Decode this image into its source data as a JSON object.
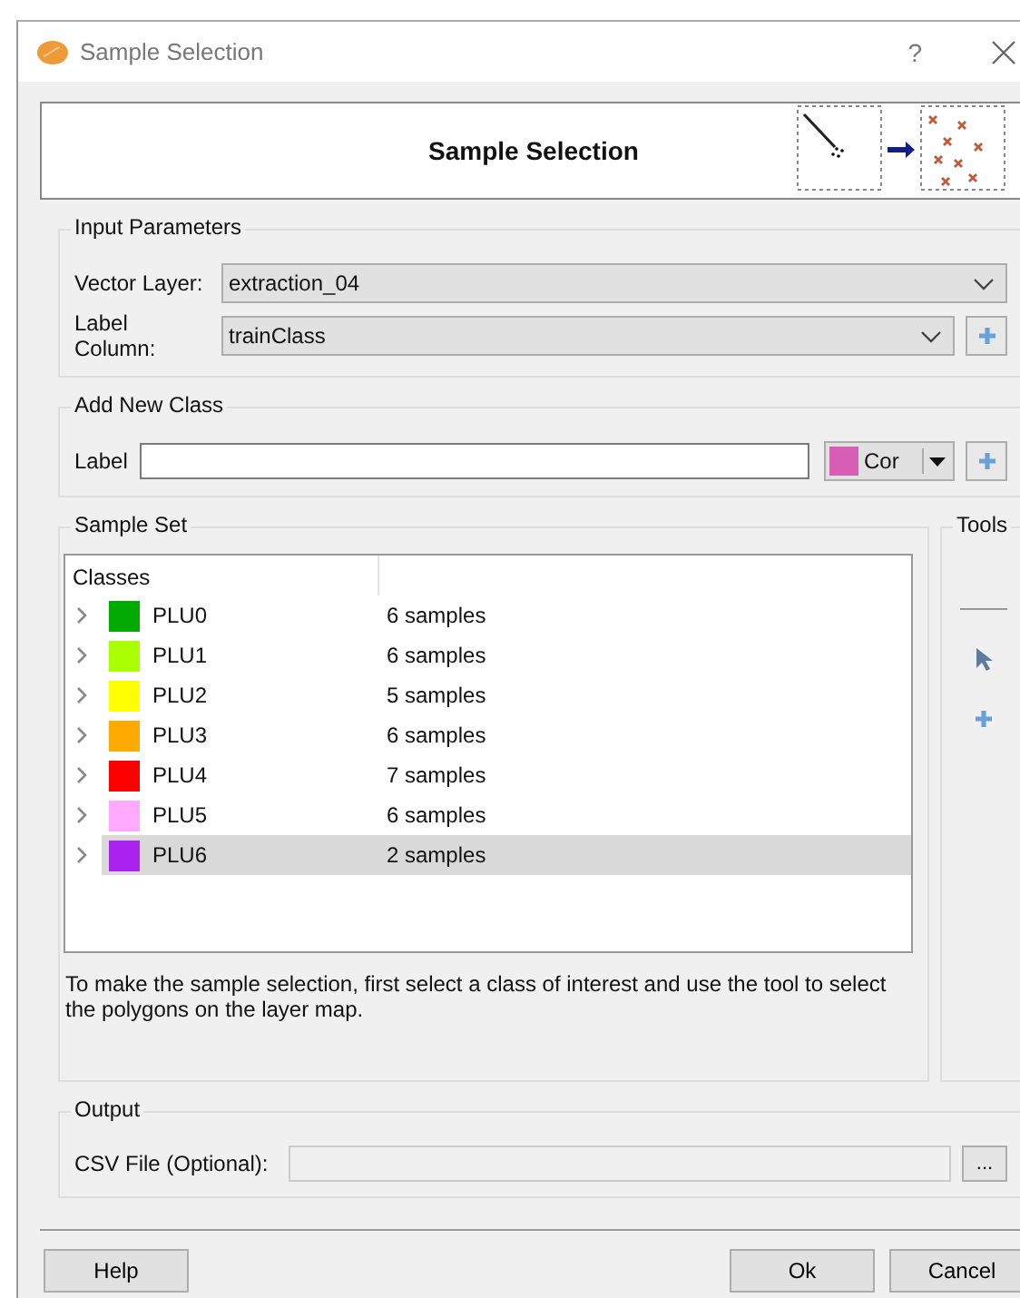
{
  "window": {
    "title": "Sample Selection",
    "help": "?"
  },
  "banner": {
    "title": "Sample Selection"
  },
  "input_parameters": {
    "title": "Input Parameters",
    "vector_layer": {
      "label": "Vector Layer:",
      "value": "extraction_04"
    },
    "label_column": {
      "label": "Label Column:",
      "value": "trainClass"
    }
  },
  "add_new_class": {
    "title": "Add New Class",
    "label": "Label",
    "color": {
      "text": "Cor",
      "color": "#d65fb4"
    }
  },
  "sample_set": {
    "title": "Sample Set",
    "columns": [
      "Classes"
    ],
    "rows": [
      {
        "label": "PLU0",
        "count": "6 samples",
        "color": "#00aa00",
        "selected": false
      },
      {
        "label": "PLU1",
        "count": "6 samples",
        "color": "#aaff00",
        "selected": false
      },
      {
        "label": "PLU2",
        "count": "5 samples",
        "color": "#ffff00",
        "selected": false
      },
      {
        "label": "PLU3",
        "count": "6 samples",
        "color": "#ffaa00",
        "selected": false
      },
      {
        "label": "PLU4",
        "count": "7 samples",
        "color": "#ff0000",
        "selected": false
      },
      {
        "label": "PLU5",
        "count": "6 samples",
        "color": "#ffaaff",
        "selected": false
      },
      {
        "label": "PLU6",
        "count": "2 samples",
        "color": "#aa22ee",
        "selected": true
      }
    ],
    "hint": "To make the sample selection, first select a class of interest and use the tool to select the polygons on the layer map."
  },
  "tools": {
    "title": "Tools"
  },
  "output": {
    "title": "Output",
    "csv_label": "CSV File (Optional):",
    "browse": "..."
  },
  "buttons": {
    "help": "Help",
    "ok": "Ok",
    "cancel": "Cancel"
  }
}
